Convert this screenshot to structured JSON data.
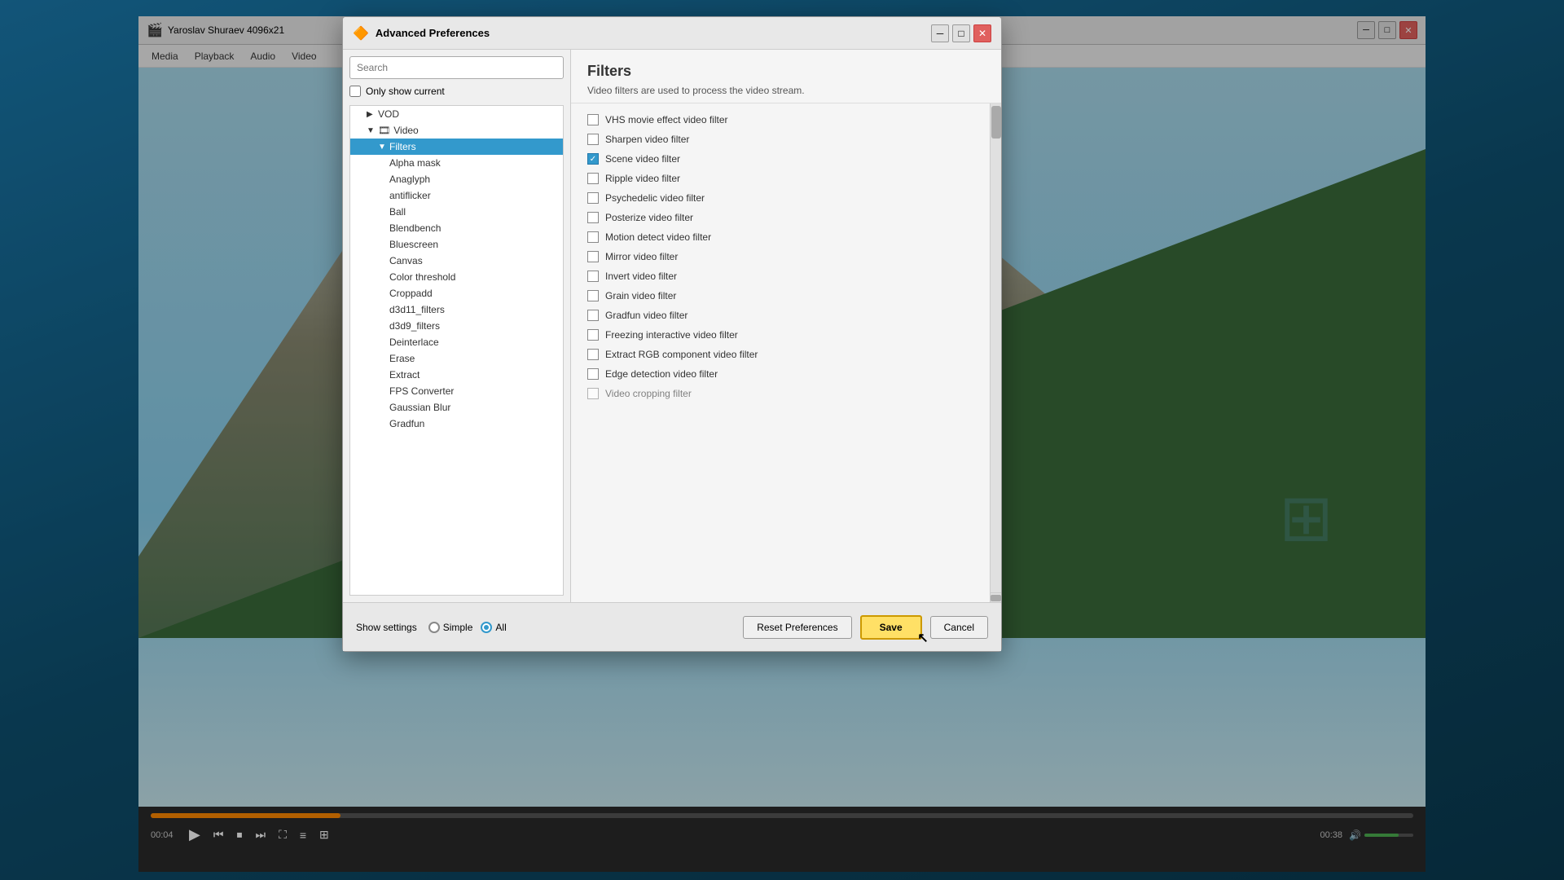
{
  "desktop": {
    "bg_color": "#1a5a7a"
  },
  "vlc_window": {
    "title": "Yaroslav Shuraev 4096x21",
    "icon": "🎬",
    "menu_items": [
      "Media",
      "Playback",
      "Audio",
      "Video"
    ],
    "time_current": "00:04",
    "time_total": "00:38",
    "progress_pct": 15
  },
  "dialog": {
    "title": "Advanced Preferences",
    "icon": "🔶",
    "search_placeholder": "Search",
    "only_show_current_label": "Only show current",
    "tree": {
      "items": [
        {
          "id": "vod",
          "label": "VOD",
          "level": 1,
          "arrow": "▶",
          "expanded": false
        },
        {
          "id": "video",
          "label": "Video",
          "level": 1,
          "arrow": "▼",
          "expanded": true,
          "icon": "🎞"
        },
        {
          "id": "filters",
          "label": "Filters",
          "level": 2,
          "arrow": "▼",
          "expanded": true,
          "selected": true
        },
        {
          "id": "alpha-mask",
          "label": "Alpha mask",
          "level": 3
        },
        {
          "id": "anaglyph",
          "label": "Anaglyph",
          "level": 3
        },
        {
          "id": "antiflicker",
          "label": "antiflicker",
          "level": 3
        },
        {
          "id": "ball",
          "label": "Ball",
          "level": 3
        },
        {
          "id": "blendbench",
          "label": "Blendbench",
          "level": 3
        },
        {
          "id": "bluescreen",
          "label": "Bluescreen",
          "level": 3
        },
        {
          "id": "canvas",
          "label": "Canvas",
          "level": 3
        },
        {
          "id": "color-threshold",
          "label": "Color threshold",
          "level": 3
        },
        {
          "id": "croppadd",
          "label": "Croppadd",
          "level": 3
        },
        {
          "id": "d3d11-filters",
          "label": "d3d11_filters",
          "level": 3
        },
        {
          "id": "d3d9-filters",
          "label": "d3d9_filters",
          "level": 3
        },
        {
          "id": "deinterlace",
          "label": "Deinterlace",
          "level": 3
        },
        {
          "id": "erase",
          "label": "Erase",
          "level": 3
        },
        {
          "id": "extract",
          "label": "Extract",
          "level": 3
        },
        {
          "id": "fps-converter",
          "label": "FPS Converter",
          "level": 3
        },
        {
          "id": "gaussian-blur",
          "label": "Gaussian Blur",
          "level": 3
        },
        {
          "id": "gradfun",
          "label": "Gradfun",
          "level": 3
        }
      ]
    },
    "filters_section": {
      "title": "Filters",
      "description": "Video filters are used to process the video stream.",
      "items": [
        {
          "id": "vhs",
          "label": "VHS movie effect video filter",
          "checked": false
        },
        {
          "id": "sharpen",
          "label": "Sharpen video filter",
          "checked": false
        },
        {
          "id": "scene",
          "label": "Scene video filter",
          "checked": true
        },
        {
          "id": "ripple",
          "label": "Ripple video filter",
          "checked": false
        },
        {
          "id": "psychedelic",
          "label": "Psychedelic video filter",
          "checked": false
        },
        {
          "id": "posterize",
          "label": "Posterize video filter",
          "checked": false
        },
        {
          "id": "motion-detect",
          "label": "Motion detect video filter",
          "checked": false
        },
        {
          "id": "mirror",
          "label": "Mirror video filter",
          "checked": false
        },
        {
          "id": "invert",
          "label": "Invert video filter",
          "checked": false
        },
        {
          "id": "grain",
          "label": "Grain video filter",
          "checked": false
        },
        {
          "id": "gradfun",
          "label": "Gradfun video filter",
          "checked": false
        },
        {
          "id": "freezing",
          "label": "Freezing interactive video filter",
          "checked": false
        },
        {
          "id": "extract-rgb",
          "label": "Extract RGB component video filter",
          "checked": false
        },
        {
          "id": "edge-detection",
          "label": "Edge detection video filter",
          "checked": false
        },
        {
          "id": "video-cropping",
          "label": "Video cropping filter",
          "checked": false
        }
      ]
    },
    "footer": {
      "show_settings_label": "Show settings",
      "radio_simple_label": "Simple",
      "radio_all_label": "All",
      "radio_selected": "all",
      "btn_reset_label": "Reset Preferences",
      "btn_save_label": "Save",
      "btn_cancel_label": "Cancel"
    },
    "window_controls": {
      "minimize": "─",
      "maximize": "□",
      "close": "✕"
    }
  }
}
